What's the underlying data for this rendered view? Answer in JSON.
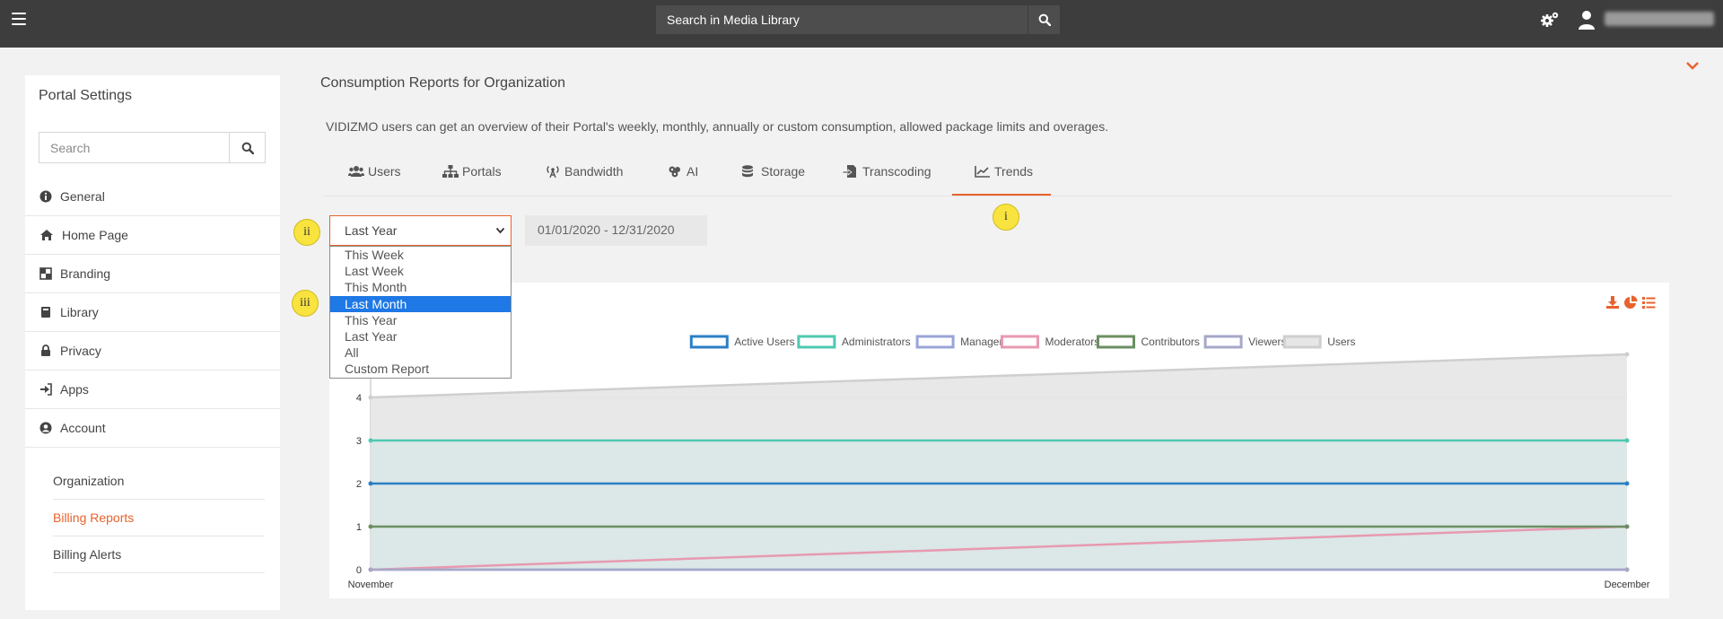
{
  "header": {
    "search_placeholder": "Search in Media Library"
  },
  "sidebar": {
    "title": "Portal Settings",
    "search_placeholder": "Search",
    "items": [
      {
        "label": "General",
        "icon": "info-circle-icon"
      },
      {
        "label": "Home Page",
        "icon": "home-icon"
      },
      {
        "label": "Branding",
        "icon": "branding-icon"
      },
      {
        "label": "Library",
        "icon": "book-icon"
      },
      {
        "label": "Privacy",
        "icon": "lock-icon"
      },
      {
        "label": "Apps",
        "icon": "sign-in-icon"
      },
      {
        "label": "Account",
        "icon": "user-circle-icon"
      }
    ],
    "subitems": [
      {
        "label": "Organization"
      },
      {
        "label": "Billing Reports",
        "active": true
      },
      {
        "label": "Billing Alerts"
      }
    ]
  },
  "main": {
    "title": "Consumption Reports for Organization",
    "description": "VIDIZMO users can get an overview of their Portal's weekly, monthly, annually or custom consumption, allowed package limits and overages.",
    "tabs": [
      {
        "label": "Users",
        "icon": "users-icon"
      },
      {
        "label": "Portals",
        "icon": "sitemap-icon"
      },
      {
        "label": "Bandwidth",
        "icon": "broadcast-icon"
      },
      {
        "label": "AI",
        "icon": "ai-icon"
      },
      {
        "label": "Storage",
        "icon": "database-icon"
      },
      {
        "label": "Transcoding",
        "icon": "transcode-icon"
      },
      {
        "label": "Trends",
        "icon": "line-chart-icon",
        "active": true
      }
    ],
    "period": {
      "selected": "Last Year",
      "options": [
        "This Week",
        "Last Week",
        "This Month",
        "Last Month",
        "This Year",
        "Last Year",
        "All",
        "Custom Report"
      ],
      "highlighted": "Last Month"
    },
    "date_range": "01/01/2020 - 12/31/2020"
  },
  "annotations": {
    "i": "i",
    "ii": "ii",
    "iii": "iii"
  },
  "colors": {
    "accent": "#e8622d",
    "topbar": "#3d3d3d",
    "highlight": "#1e78e6",
    "badge": "#f8e33f"
  },
  "chart_data": {
    "type": "area",
    "x": [
      "November",
      "December"
    ],
    "yticks": [
      0,
      1,
      2,
      3,
      4
    ],
    "ylim": [
      0,
      5
    ],
    "legend_position": "top",
    "series": [
      {
        "name": "Active Users",
        "values": [
          2,
          2
        ],
        "color": "#2b7fc4",
        "fill": "none"
      },
      {
        "name": "Administrators",
        "values": [
          3,
          3
        ],
        "color": "#4ec9b0",
        "fill": "none"
      },
      {
        "name": "Managers",
        "values": [
          0,
          0
        ],
        "color": "#9aa4d8",
        "fill": "none"
      },
      {
        "name": "Moderators",
        "values": [
          0,
          1
        ],
        "color": "#e79ab0",
        "fill": "none"
      },
      {
        "name": "Contributors",
        "values": [
          1,
          1
        ],
        "color": "#6b8f62",
        "fill": "none"
      },
      {
        "name": "Viewers",
        "values": [
          0,
          0
        ],
        "color": "#a6a8c8",
        "fill": "none"
      },
      {
        "name": "Users",
        "values": [
          4,
          5
        ],
        "color": "#cfcfcf",
        "fill": "#e6e6e6"
      }
    ]
  }
}
